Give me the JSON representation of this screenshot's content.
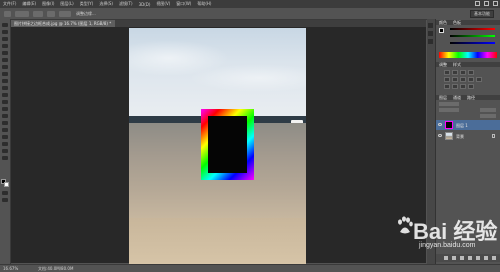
{
  "menubar": {
    "items": [
      "文件(F)",
      "编辑(E)",
      "图像(I)",
      "图层(L)",
      "类型(Y)",
      "选择(S)",
      "滤镜(T)",
      "3D(D)",
      "视图(V)",
      "窗口(W)",
      "帮助(H)"
    ]
  },
  "options": {
    "label": "调整边缘...",
    "workspace": "基本功能"
  },
  "document": {
    "tab_title": "图片拼接之边框合成.jpg @ 16.7% (图层 1, RGB/8) *"
  },
  "status": {
    "zoom": "16.67%",
    "doc_size": "文档:40.0M/80.0M"
  },
  "panels": {
    "color_tab": "颜色",
    "swatches_tab": "色板",
    "adjust_tab": "调整",
    "styles_tab": "样式",
    "layers_tab": "图层",
    "channels_tab": "通道",
    "paths_tab": "路径",
    "layers": [
      {
        "name": "图层 1",
        "selected": true
      },
      {
        "name": "背景",
        "selected": false
      }
    ]
  },
  "watermark": {
    "brand": "Bai 经验",
    "url": "jingyan.baidu.com"
  },
  "colors": {
    "selected_layer": "#4b6d99",
    "foreground": "#000000",
    "background": "#ffffff"
  }
}
